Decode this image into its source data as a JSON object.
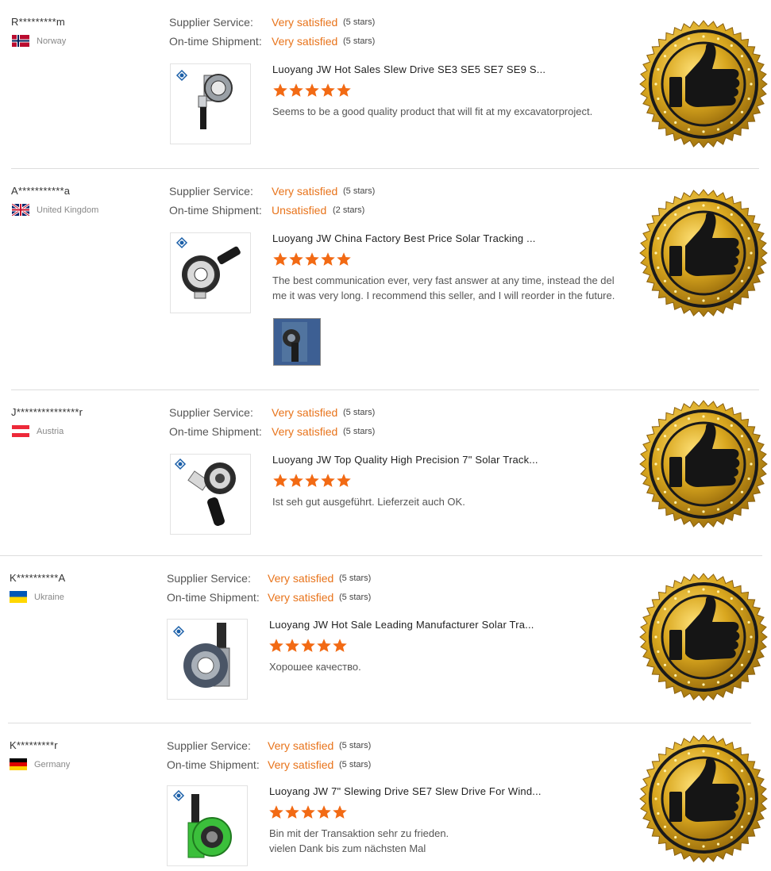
{
  "labels": {
    "supplier_service": "Supplier Service:",
    "ontime_shipment": "On-time Shipment:"
  },
  "colors": {
    "rating_text": "#e8731a",
    "star": "#f26a14",
    "divider": "#dddddd",
    "badge_gold": "#d4a21a"
  },
  "badge_icon": "thumbs-up-icon",
  "reviews": [
    {
      "buyer": "R*********m",
      "country": "Norway",
      "flag": "norway-flag-icon",
      "supplier_service": "Very satisfied",
      "supplier_service_stars": "(5 stars)",
      "ontime_shipment": "Very satisfied",
      "ontime_shipment_stars": "(5 stars)",
      "product_title": "Luoyang JW Hot Sales Slew Drive SE3 SE5 SE7 SE9 S...",
      "rating": 5,
      "comment": "Seems to be a good quality product that will fit at my excavatorproject."
    },
    {
      "buyer": "A***********a",
      "country": "United Kingdom",
      "flag": "uk-flag-icon",
      "supplier_service": "Very satisfied",
      "supplier_service_stars": "(5 stars)",
      "ontime_shipment": "Unsatisfied",
      "ontime_shipment_stars": "(2 stars)",
      "product_title": "Luoyang JW China Factory Best Price Solar Tracking ...",
      "rating": 5,
      "comment": "The best communication ever, very fast answer at any time, instead the del\nme it was very long. I recommend this seller, and I will reorder in the future."
    },
    {
      "buyer": "J***************r",
      "country": "Austria",
      "flag": "austria-flag-icon",
      "supplier_service": "Very satisfied",
      "supplier_service_stars": "(5 stars)",
      "ontime_shipment": "Very satisfied",
      "ontime_shipment_stars": "(5 stars)",
      "product_title": "Luoyang JW Top Quality High Precision 7\" Solar Track...",
      "rating": 5,
      "comment": "Ist seh gut ausgeführt. Lieferzeit auch OK."
    },
    {
      "buyer": "K**********A",
      "country": "Ukraine",
      "flag": "ukraine-flag-icon",
      "supplier_service": "Very satisfied",
      "supplier_service_stars": "(5 stars)",
      "ontime_shipment": "Very satisfied",
      "ontime_shipment_stars": "(5 stars)",
      "product_title": "Luoyang JW Hot Sale Leading Manufacturer Solar Tra...",
      "rating": 5,
      "comment": "Хорошее качество."
    },
    {
      "buyer": "K*********r",
      "country": "Germany",
      "flag": "germany-flag-icon",
      "supplier_service": "Very satisfied",
      "supplier_service_stars": "(5 stars)",
      "ontime_shipment": "Very satisfied",
      "ontime_shipment_stars": "(5 stars)",
      "product_title": "Luoyang JW 7\" Slewing Drive SE7 Slew Drive For Wind...",
      "rating": 5,
      "comment": "Bin mit der Transaktion sehr zu frieden.\nvielen Dank bis zum nächsten Mal"
    }
  ]
}
